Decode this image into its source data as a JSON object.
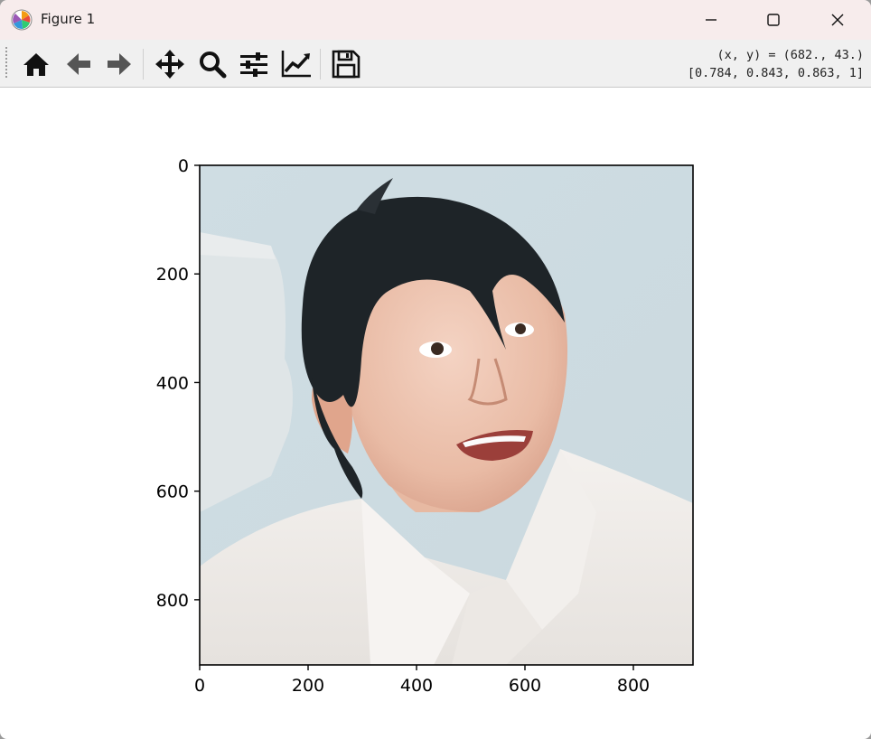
{
  "window": {
    "title": "Figure 1"
  },
  "toolbar": {
    "buttons": [
      "home-icon",
      "back-arrow-icon",
      "forward-arrow-icon",
      "pan-icon",
      "zoom-icon",
      "subplots-icon",
      "edit-axes-icon",
      "save-icon"
    ],
    "coord_line1": "(x, y) = (682., 43.)",
    "coord_line2": "[0.784, 0.843, 0.863, 1]"
  },
  "chart_data": {
    "type": "image",
    "image_description_subject": "portrait photo",
    "x_ticks": [
      0,
      200,
      400,
      600,
      800
    ],
    "y_ticks": [
      0,
      200,
      400,
      600,
      800
    ],
    "xlim": [
      0,
      910
    ],
    "ylim": [
      920,
      0
    ],
    "x_tick_labels": [
      "0",
      "200",
      "400",
      "600",
      "800"
    ],
    "y_tick_labels": [
      "0",
      "200",
      "400",
      "600",
      "800"
    ]
  }
}
